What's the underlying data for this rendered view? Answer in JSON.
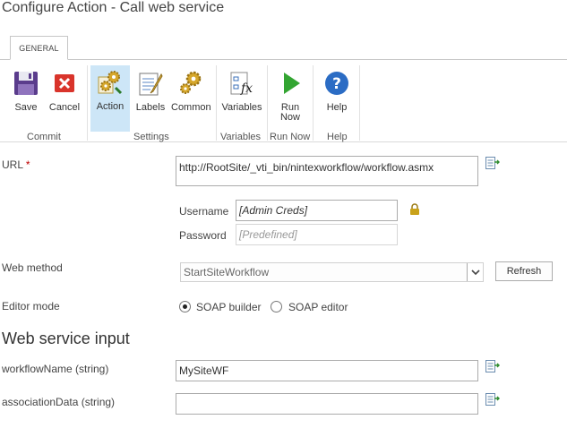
{
  "window": {
    "title": "Configure Action - Call web service"
  },
  "ribbon": {
    "tab": "GENERAL",
    "buttons": {
      "save": "Save",
      "cancel": "Cancel",
      "action": "Action",
      "labels": "Labels",
      "common": "Common",
      "variables": "Variables",
      "run_now_line1": "Run",
      "run_now_line2": "Now",
      "help": "Help"
    },
    "groups": {
      "commit": "Commit",
      "settings": "Settings",
      "variables": "Variables",
      "run_now": "Run Now",
      "help": "Help"
    }
  },
  "form": {
    "url": {
      "label": "URL",
      "required_mark": "*",
      "value": "http://RootSite/_vti_bin/nintexworkflow/workflow.asmx"
    },
    "username": {
      "label": "Username",
      "value": "[Admin Creds]"
    },
    "password": {
      "label": "Password",
      "value": "[Predefined]"
    },
    "web_method": {
      "label": "Web method",
      "value": "StartSiteWorkflow",
      "refresh_label": "Refresh"
    },
    "editor_mode": {
      "label": "Editor mode",
      "options": [
        "SOAP builder",
        "SOAP editor"
      ],
      "selected": "SOAP builder"
    },
    "section_title": "Web service input",
    "inputs": [
      {
        "label": "workflowName (string)",
        "value": "MySiteWF"
      },
      {
        "label": "associationData (string)",
        "value": ""
      }
    ]
  },
  "colors": {
    "active_button_bg": "#cde6f7",
    "required": "#bf0000",
    "cancel_red": "#d9342b",
    "run_green": "#33a532",
    "help_blue": "#2b6cc4",
    "lock_gold": "#c9a21a"
  },
  "icons": {
    "save": "floppy-disk-icon",
    "cancel": "red-x-icon",
    "action": "gears-icon",
    "labels": "notepad-pencil-icon",
    "common": "gear-icon",
    "variables": "fx-icon",
    "run_now": "play-icon",
    "help": "question-icon",
    "lookup": "insert-reference-icon",
    "lock": "lock-icon"
  }
}
